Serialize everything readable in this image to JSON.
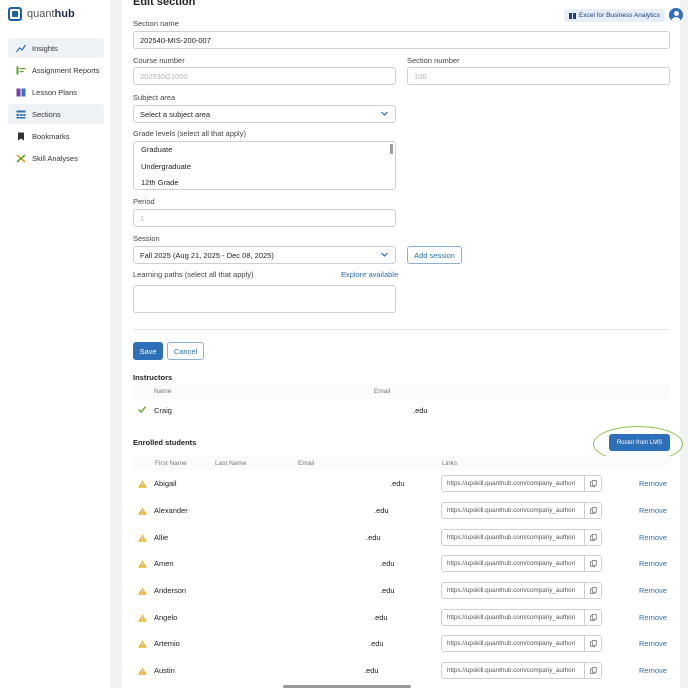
{
  "app": {
    "logo_text": "quanthub"
  },
  "sidebar": {
    "items": [
      {
        "label": "Insights",
        "icon": "chart-line-icon",
        "active": true
      },
      {
        "label": "Assignment Reports",
        "icon": "report-icon",
        "active": false
      },
      {
        "label": "Lesson Plans",
        "icon": "book-icon",
        "active": false
      },
      {
        "label": "Sections",
        "icon": "sections-icon",
        "active": true
      },
      {
        "label": "Bookmarks",
        "icon": "bookmark-icon",
        "active": false
      },
      {
        "label": "Skill Analyses",
        "icon": "tools-icon",
        "active": false
      }
    ]
  },
  "header": {
    "title": "Edit section",
    "course_chip": "Excel for Business Analytics"
  },
  "form": {
    "section_name_label": "Section name",
    "section_name_value": "202540-MIS-200-007",
    "course_number_label": "Course number",
    "course_number_placeholder": "202530G1000",
    "section_number_label": "Section number",
    "section_number_placeholder": "100",
    "subject_area_label": "Subject area",
    "subject_area_value": "Select a subject area",
    "grade_levels_label": "Grade levels (select all that apply)",
    "grade_levels_options": [
      "Graduate",
      "Undergraduate",
      "12th Grade"
    ],
    "period_label": "Period",
    "period_placeholder": "1",
    "session_label": "Session",
    "session_value": "Fall 2025 (Aug 21, 2025 - Dec 08, 2025)",
    "add_session_label": "Add session",
    "learning_paths_label": "Learning paths (select all that apply)",
    "explore_label": "Explore available",
    "save_label": "Save",
    "cancel_label": "Cancel"
  },
  "instructors": {
    "title": "Instructors",
    "col_name": "Name",
    "col_email": "Email",
    "rows": [
      {
        "name": "Craig",
        "email": ".edu"
      }
    ]
  },
  "students": {
    "title": "Enrolled students",
    "roster_label": "Roster from LMS",
    "col_first": "First Name",
    "col_last": "Last Name",
    "col_email": "Email",
    "col_links": "Links",
    "remove_label": "Remove",
    "rows": [
      {
        "first": "Abigail",
        "email": ".edu",
        "link": "https://upskill.quanthub.com/company_authori"
      },
      {
        "first": "Alexander",
        "email": ".edu",
        "link": "https://upskill.quanthub.com/company_authori"
      },
      {
        "first": "Allie",
        "email": ".edu",
        "link": "https://upskill.quanthub.com/company_authori"
      },
      {
        "first": "Amen",
        "email": ".edu",
        "link": "https://upskill.quanthub.com/company_authori"
      },
      {
        "first": "Anderson",
        "email": ".edu",
        "link": "https://upskill.quanthub.com/company_authori"
      },
      {
        "first": "Angelo",
        "email": ".edu",
        "link": "https://upskill.quanthub.com/company_authori"
      },
      {
        "first": "Artemio",
        "email": ".edu",
        "link": "https://upskill.quanthub.com/company_authori"
      },
      {
        "first": "Austin",
        "email": ".edu",
        "link": "https://upskill.quanthub.com/company_authori"
      }
    ]
  },
  "colors": {
    "accent": "#2d6fb8",
    "warning": "#f0b429",
    "highlight_ring": "#8cc152",
    "check": "#5aa02c"
  }
}
